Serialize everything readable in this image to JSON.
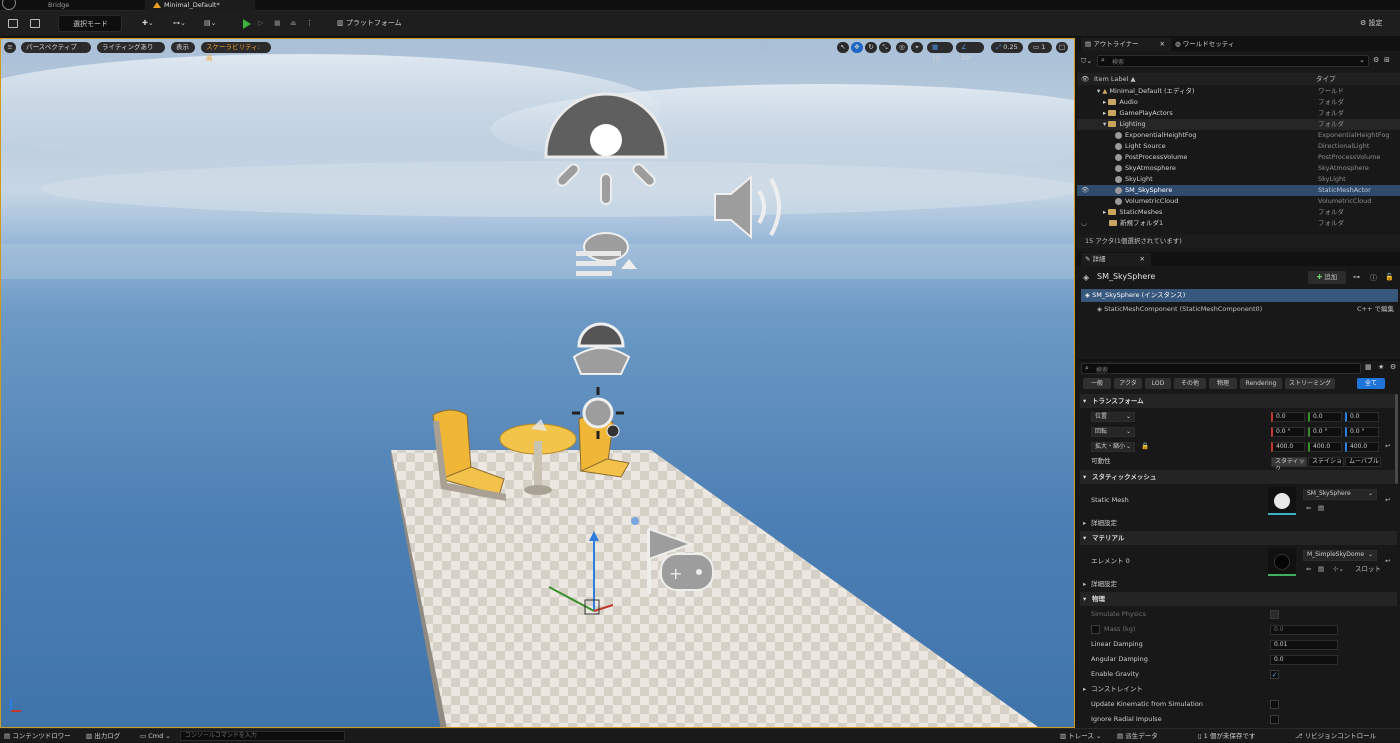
{
  "tabs": {
    "bridge": "Bridge",
    "level": "Minimal_Default*"
  },
  "toolbar": {
    "mode": "選択モード",
    "platform": "プラットフォーム",
    "settings": "設定"
  },
  "viewport": {
    "perspective": "パースペクティブ",
    "lighting": "ライティングあり",
    "show": "表示",
    "scalability": "スケーラビリティ:高",
    "grid_snap": "10",
    "rot_snap": "10°",
    "scale_snap": "0.25",
    "cam_speed": "1"
  },
  "outliner": {
    "tab_title": "アウトライナー",
    "world_tab": "ワールドセッティ",
    "search_placeholder": "検索",
    "col_label": "Item Label ▲",
    "col_type": "タイプ",
    "rows": [
      {
        "label": "Minimal_Default (エディタ)",
        "type": "ワールド"
      },
      {
        "label": "Audio",
        "type": "フォルダ"
      },
      {
        "label": "GamePlayActors",
        "type": "フォルダ"
      },
      {
        "label": "Lighting",
        "type": "フォルダ"
      },
      {
        "label": "ExponentialHeightFog",
        "type": "ExponentialHeightFog"
      },
      {
        "label": "Light Source",
        "type": "DirectionalLight"
      },
      {
        "label": "PostProcessVolume",
        "type": "PostProcessVolume"
      },
      {
        "label": "SkyAtmosphere",
        "type": "SkyAtmosphere"
      },
      {
        "label": "SkyLight",
        "type": "SkyLight"
      },
      {
        "label": "SM_SkySphere",
        "type": "StaticMeshActor"
      },
      {
        "label": "VolumetricCloud",
        "type": "VolumetricCloud"
      },
      {
        "label": "StaticMeshes",
        "type": "フォルダ"
      },
      {
        "label": "新規フォルダ1",
        "type": "フォルダ"
      }
    ],
    "status": "15 アクタ(1個選択されています)"
  },
  "details": {
    "tab_title": "詳細",
    "actor_name": "SM_SkySphere",
    "add_button": "追加",
    "instance_row": "SM_SkySphere (インスタンス)",
    "component_row": "StaticMeshComponent (StaticMeshComponent0)",
    "component_action": "C++ で編集",
    "search_placeholder": "検索",
    "filters": [
      "一般",
      "アクタ",
      "LOD",
      "その他",
      "物理",
      "Rendering",
      "ストリーミング",
      "全て"
    ],
    "transform_header": "トランスフォーム",
    "location_label": "位置",
    "rotation_label": "回転",
    "scale_label": "拡大・縮小",
    "location": [
      "0.0",
      "0.0",
      "0.0"
    ],
    "rotation": [
      "0.0 °",
      "0.0 °",
      "0.0 °"
    ],
    "scale": [
      "400.0",
      "400.0",
      "400.0"
    ],
    "mobility_label": "可動性",
    "mobility_options": [
      "スタティック",
      "ステイショ",
      "ムーバブル"
    ],
    "static_mesh_header": "スタティックメッシュ",
    "static_mesh_label": "Static Mesh",
    "static_mesh_value": "SM_SkySphere",
    "advanced1": "詳細設定",
    "material_header": "マテリアル",
    "element_label": "エレメント 0",
    "material_value": "M_SimpleSkyDome",
    "slot_label": "スロット",
    "advanced2": "詳細設定",
    "physics_header": "物理",
    "simulate_physics": "Simulate Physics",
    "mass_label": "Mass (kg)",
    "mass_value": "0.0",
    "linear_damping": "Linear Damping",
    "linear_value": "0.01",
    "angular_damping": "Angular Damping",
    "angular_value": "0.0",
    "enable_gravity": "Enable Gravity",
    "constraints": "コンストレイント",
    "update_kinematic": "Update Kinematic from Simulation",
    "ignore_radial": "Ignore Radial Impulse"
  },
  "bottom": {
    "content_drawer": "コンテンツドロワー",
    "output_log": "出力ログ",
    "cmd": "Cmd",
    "console_placeholder": "コンソールコマンドを入力",
    "trace": "トレース",
    "derived_data": "派生データ",
    "unsaved": "1 個が未保存です",
    "revision": "リビジョンコントロール"
  }
}
